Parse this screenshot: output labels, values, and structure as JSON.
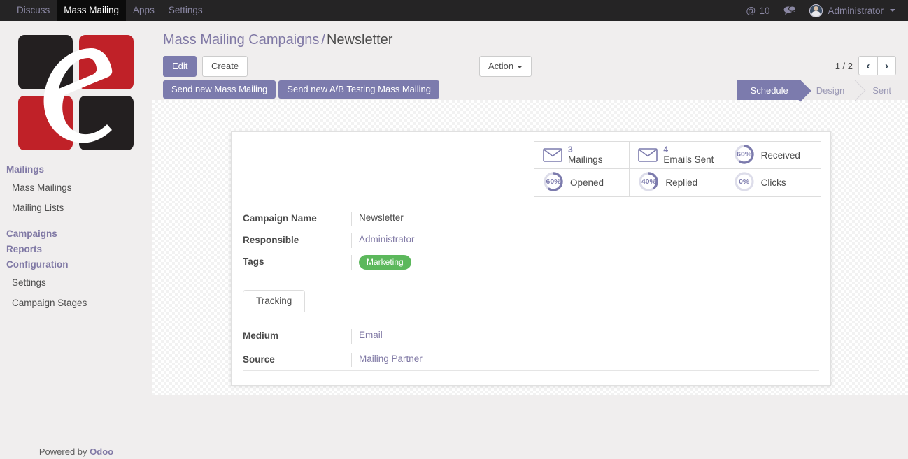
{
  "navbar": {
    "menus": [
      {
        "label": "Discuss",
        "active": false
      },
      {
        "label": "Mass Mailing",
        "active": true
      },
      {
        "label": "Apps",
        "active": false
      },
      {
        "label": "Settings",
        "active": false
      }
    ],
    "mention_icon": "at-icon",
    "mention_count": "10",
    "chat_icon": "chat-bubble-icon",
    "user_name": "Administrator",
    "user_caret_icon": "caret-down-icon"
  },
  "sidebar": {
    "logo_name": "company-logo",
    "sections": [
      {
        "title": "Mailings",
        "items": [
          {
            "label": "Mass Mailings"
          },
          {
            "label": "Mailing Lists"
          }
        ]
      },
      {
        "title": "Campaigns",
        "items": []
      },
      {
        "title": "Reports",
        "items": []
      },
      {
        "title": "Configuration",
        "items": [
          {
            "label": "Settings"
          },
          {
            "label": "Campaign Stages"
          }
        ]
      }
    ],
    "footer_prefix": "Powered by ",
    "footer_brand": "Odoo"
  },
  "breadcrumb": {
    "parent": "Mass Mailing Campaigns",
    "separator": "/",
    "current": "Newsletter"
  },
  "controls": {
    "edit_label": "Edit",
    "create_label": "Create",
    "action_label": "Action",
    "action_caret_icon": "caret-down-icon",
    "pager_text": "1 / 2",
    "prev_icon": "chevron-left-icon",
    "next_icon": "chevron-right-icon",
    "prev_glyph": "‹",
    "next_glyph": "›"
  },
  "statusbar": {
    "buttons": [
      {
        "label": "Send new Mass Mailing"
      },
      {
        "label": "Send new A/B Testing Mass Mailing"
      }
    ],
    "stages": [
      {
        "label": "Schedule",
        "state": "active"
      },
      {
        "label": "Design",
        "state": "pending"
      },
      {
        "label": "Sent",
        "state": "pending"
      }
    ]
  },
  "stats": [
    {
      "icon": "envelope-icon",
      "type": "count",
      "value": "3",
      "label": "Mailings"
    },
    {
      "icon": "envelope-icon",
      "type": "count",
      "value": "4",
      "label": "Emails Sent"
    },
    {
      "icon": "donut-icon",
      "type": "percent",
      "value": "60%",
      "percent": 60,
      "label": "Received"
    },
    {
      "icon": "donut-icon",
      "type": "percent",
      "value": "60%",
      "percent": 60,
      "label": "Opened"
    },
    {
      "icon": "donut-icon",
      "type": "percent",
      "value": "40%",
      "percent": 40,
      "label": "Replied"
    },
    {
      "icon": "donut-icon",
      "type": "percent",
      "value": "0%",
      "percent": 0,
      "label": "Clicks"
    }
  ],
  "form": {
    "campaign_name_label": "Campaign Name",
    "campaign_name_value": "Newsletter",
    "responsible_label": "Responsible",
    "responsible_value": "Administrator",
    "tags_label": "Tags",
    "tags": [
      {
        "label": "Marketing",
        "color": "#5cb85c"
      }
    ]
  },
  "notebook": {
    "tabs": [
      {
        "label": "Tracking",
        "active": true
      }
    ],
    "medium_label": "Medium",
    "medium_value": "Email",
    "source_label": "Source",
    "source_value": "Mailing Partner"
  },
  "colors": {
    "accent_purple": "#7c7bad",
    "link_purple": "#8079a5",
    "navbar_bg": "#252425",
    "tag_green": "#5cb85c",
    "logo_red": "#c02128",
    "logo_black": "#231f20"
  }
}
